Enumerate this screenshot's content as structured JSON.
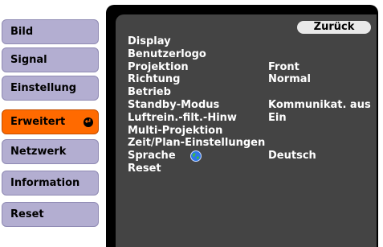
{
  "sidebar": {
    "items": [
      {
        "label": "Bild"
      },
      {
        "label": "Signal"
      },
      {
        "label": "Einstellung"
      },
      {
        "label": "Erweitert"
      },
      {
        "label": "Netzwerk"
      },
      {
        "label": "Information"
      },
      {
        "label": "Reset"
      }
    ],
    "active_index": 3
  },
  "panel": {
    "back_label": "Zurück",
    "items": [
      {
        "label": "Display",
        "value": ""
      },
      {
        "label": "Benutzerlogo",
        "value": ""
      },
      {
        "label": "Projektion",
        "value": "Front"
      },
      {
        "label": "Richtung",
        "value": "Normal"
      },
      {
        "label": "Betrieb",
        "value": ""
      },
      {
        "label": "Standby-Modus",
        "value": "Kommunikat. aus"
      },
      {
        "label": "Luftrein.-filt.-Hinw",
        "value": "Ein"
      },
      {
        "label": "Multi-Projektion",
        "value": ""
      },
      {
        "label": "Zeit/Plan-Einstellungen",
        "value": ""
      },
      {
        "label": "Sprache",
        "value": "Deutsch",
        "icon": "globe-icon"
      },
      {
        "label": "Reset",
        "value": ""
      }
    ]
  },
  "colors": {
    "sidebar_button": "#b3aed1",
    "sidebar_active": "#ff6a00",
    "panel_background": "#444444"
  }
}
